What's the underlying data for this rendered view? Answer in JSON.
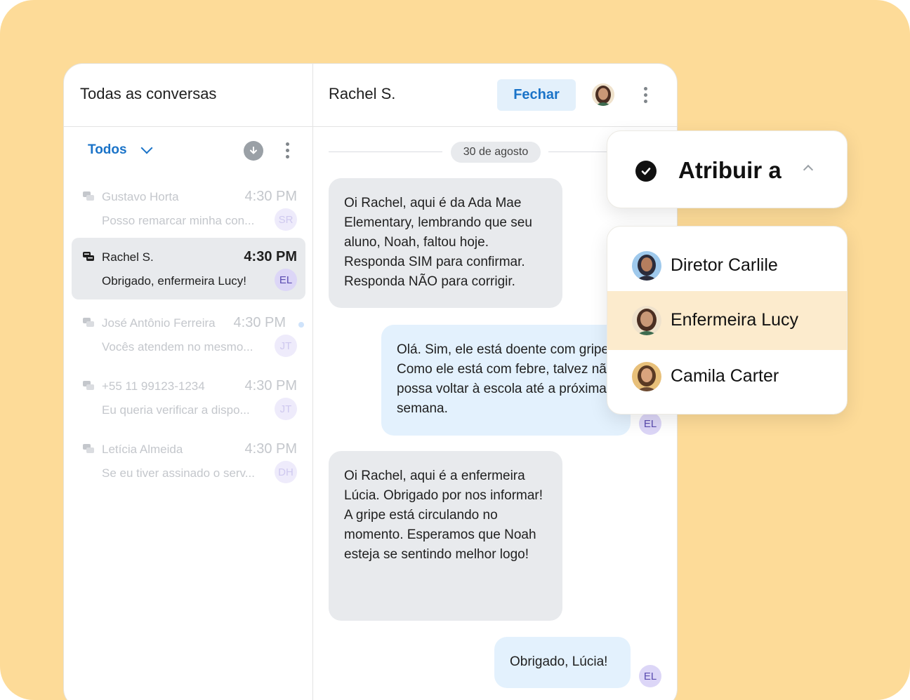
{
  "inbox": {
    "title": "Todas as conversas",
    "filter_label": "Todos",
    "conversations": [
      {
        "name": "Gustavo Horta",
        "time": "4:30 PM",
        "preview": "Posso remarcar minha con...",
        "badge": "SR"
      },
      {
        "name": "Rachel S.",
        "time": "4:30 PM",
        "preview": "Obrigado, enfermeira Lucy!",
        "badge": "EL"
      },
      {
        "name": "José Antônio Ferreira",
        "time": "4:30 PM",
        "preview": "Vocês atendem no mesmo...",
        "badge": "JT"
      },
      {
        "name": "+55 11 99123-1234",
        "time": "4:30 PM",
        "preview": "Eu queria verificar a dispo...",
        "badge": "JT"
      },
      {
        "name": "Letícia Almeida",
        "time": "4:30 PM",
        "preview": "Se eu tiver assinado o serv...",
        "badge": "DH"
      }
    ]
  },
  "chat": {
    "title": "Rachel S.",
    "close_label": "Fechar",
    "date_separator": "30 de agosto",
    "messages": [
      {
        "direction": "in",
        "text": "Oi Rachel, aqui é da Ada Mae Elementary, lembrando que seu aluno, Noah, faltou hoje. Responda SIM para confirmar. Responda NÃO para corrigir."
      },
      {
        "direction": "out",
        "text": "Olá. Sim, ele está doente com gripe. Como ele está com febre, talvez não possa voltar à escola até a próxima semana.",
        "badge": "EL"
      },
      {
        "direction": "in",
        "text": "Oi Rachel, aqui é a enfermeira Lúcia. Obrigado por nos informar! A gripe está circulando no momento. Esperamos que Noah esteja se sentindo melhor logo!"
      },
      {
        "direction": "out",
        "text": "Obrigado, Lúcia!",
        "badge": "EL"
      }
    ]
  },
  "assign": {
    "title": "Atribuir a",
    "options": [
      "Diretor Carlile",
      "Enfermeira Lucy",
      "Camila Carter"
    ],
    "selected": "Enfermeira Lucy"
  },
  "colors": {
    "backdrop": "#fddb98",
    "accent": "#1a73c8",
    "selected_row": "#fcebcd"
  }
}
